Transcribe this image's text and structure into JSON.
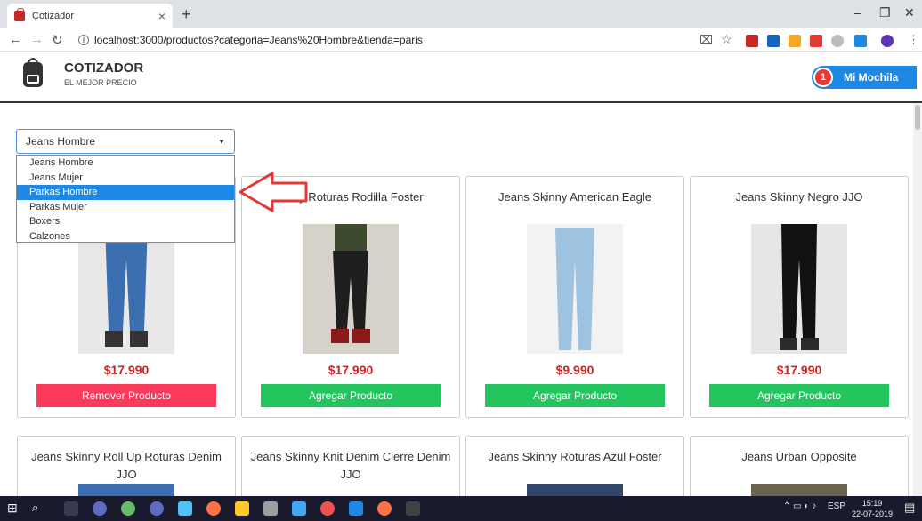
{
  "browser": {
    "tab_title": "Cotizador",
    "tab_close": "×",
    "new_tab": "+",
    "url": "localhost:3000/productos?categoria=Jeans%20Hombre&tienda=paris",
    "min": "–",
    "restore": "❐",
    "close": "✕"
  },
  "header": {
    "brand": "COTIZADOR",
    "tagline": "EL MEJOR PRECIO",
    "cart_label": "Mi Mochila",
    "cart_count": "1"
  },
  "filter": {
    "selected": "Jeans Hombre",
    "options": [
      "Jeans Hombre",
      "Jeans Mujer",
      "Parkas Hombre",
      "Parkas Mujer",
      "Boxers",
      "Calzones"
    ],
    "highlighted_index": 2
  },
  "products_row1": [
    {
      "title": "",
      "price": "$17.990",
      "button": "Remover Producto",
      "in_cart": true
    },
    {
      "title": "kinny Roturas Rodilla Foster",
      "price": "$17.990",
      "button": "Agregar Producto",
      "in_cart": false
    },
    {
      "title": "Jeans Skinny American Eagle",
      "price": "$9.990",
      "button": "Agregar Producto",
      "in_cart": false
    },
    {
      "title": "Jeans Skinny Negro JJO",
      "price": "$17.990",
      "button": "Agregar Producto",
      "in_cart": false
    }
  ],
  "products_row2": [
    {
      "title": "Jeans Skinny Roll Up Roturas Denim JJO"
    },
    {
      "title": "Jeans Skinny Knit Denim Cierre Denim JJO"
    },
    {
      "title": "Jeans Skinny Roturas Azul Foster"
    },
    {
      "title": "Jeans Urban Opposite"
    }
  ],
  "taskbar": {
    "tray": "ESP",
    "time": "15:19",
    "date": "22-07-2019"
  },
  "colors": {
    "accent": "#1e88e5",
    "add": "#22c55e",
    "remove": "#fb3a5b",
    "price": "#c62828"
  }
}
